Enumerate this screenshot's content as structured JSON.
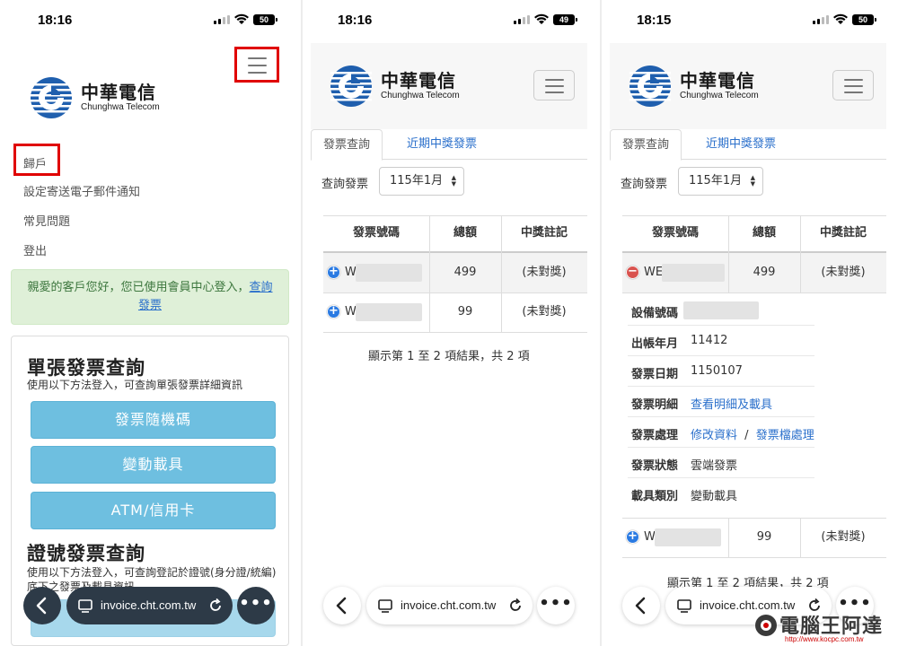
{
  "status": {
    "time_1": "18:16",
    "battery_1": "50",
    "time_2": "18:16",
    "battery_2": "49",
    "time_3": "18:15",
    "battery_3": "50"
  },
  "logo": {
    "cn": "中華電信",
    "en": "Chunghwa Telecom"
  },
  "screen1": {
    "menu": [
      "歸戶",
      "設定寄送電子郵件通知",
      "常見問題",
      "登出"
    ],
    "alert_text": "親愛的客戶您好，您已使用會員中心登入，",
    "alert_link": "查詢發票",
    "single_title": "單張發票查詢",
    "single_desc": "使用以下方法登入，可查詢單張發票詳細資訊",
    "buttons": [
      "發票隨機碼",
      "變動載具",
      "ATM/信用卡"
    ],
    "cert_title": "證號發票查詢",
    "cert_desc": "使用以下方法登入，可查詢登記於證號(身分證/統編)底下之發票及載具資訊"
  },
  "query": {
    "tab_active": "發票查詢",
    "tab_link": "近期中獎發票",
    "label": "查詢發票",
    "period": "115年1月"
  },
  "table": {
    "headers": [
      "發票號碼",
      "總額",
      "中獎註記"
    ],
    "rows": [
      {
        "prefix": "W",
        "amount": "499",
        "note": "(未對獎)"
      },
      {
        "prefix": "W",
        "amount": "99",
        "note": "(未對獎)"
      }
    ],
    "row1_prefix_expanded": "WE",
    "summary": "顯示第 1 至 2 項結果，共 2 項"
  },
  "detail": {
    "device_label": "設備號碼",
    "period_label": "出帳年月",
    "period_value": "11412",
    "date_label": "發票日期",
    "date_value": "1150107",
    "items_label": "發票明細",
    "items_link": "查看明細及載具",
    "process_label": "發票處理",
    "process_link1": "修改資料",
    "process_sep": "/",
    "process_link2": "發票檔處理",
    "status_label": "發票狀態",
    "status_value": "雲端發票",
    "carrier_label": "載具類別",
    "carrier_value": "變動載具"
  },
  "browser": {
    "url": "invoice.cht.com.tw"
  },
  "watermark": {
    "text": "電腦王阿達",
    "url": "http://www.kocpc.com.tw"
  },
  "colors": {
    "accent_blue": "#2a6fcb",
    "button_blue": "#6ebfe0",
    "highlight_red": "#e00000",
    "alert_green": "#dff0d8"
  }
}
